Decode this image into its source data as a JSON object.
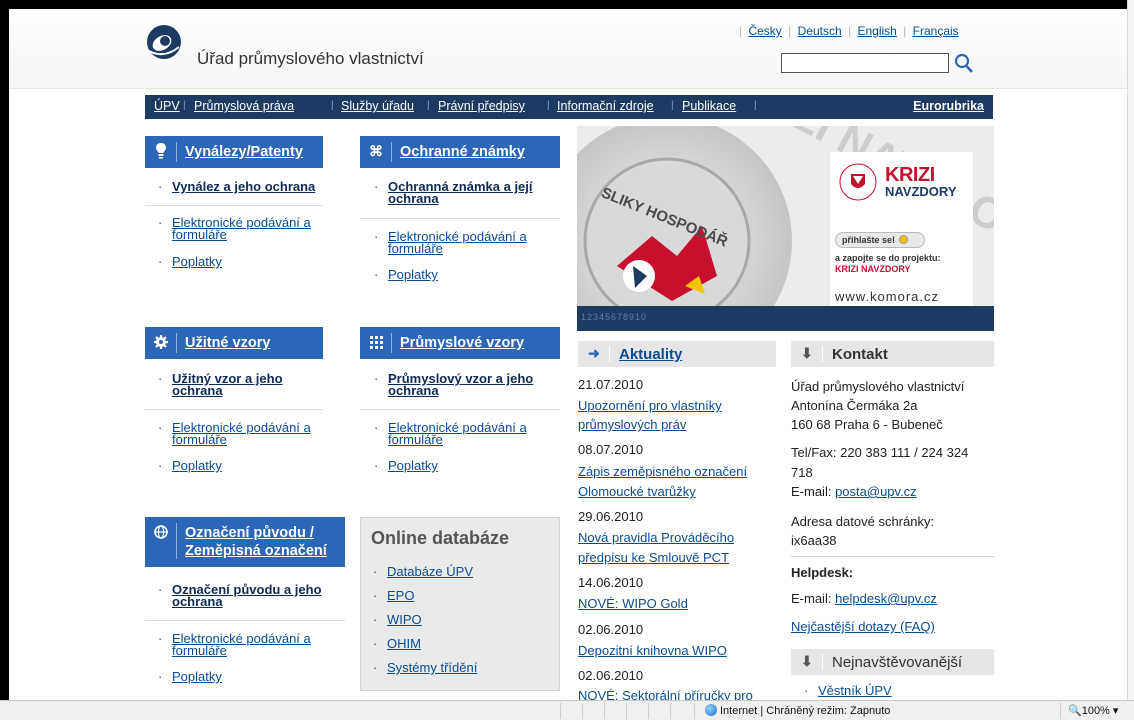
{
  "header": {
    "site_title": "Úřad průmyslového vlastnictví",
    "languages": [
      "Česky",
      "Deutsch",
      "English",
      "Français"
    ],
    "search_value": ""
  },
  "nav": {
    "items": [
      "ÚPV",
      "Průmyslová práva",
      "Služby úřadu",
      "Právní předpisy",
      "Informační zdroje",
      "Publikace"
    ],
    "right": "Eurorubrika"
  },
  "boxes": {
    "vynalezy": {
      "title": "Vynálezy/Patenty",
      "links": [
        "Vynález a jeho ochrana",
        "Elektronické podávání a",
        "formuláře",
        "Poplatky"
      ]
    },
    "znamky": {
      "title": "Ochranné známky",
      "links": [
        "Ochranná známka a její",
        "ochrana",
        "Elektronické podávání a",
        "formuláře",
        "Poplatky"
      ]
    },
    "uzitne": {
      "title": "Užitné vzory",
      "links": [
        "Užitný vzor a jeho",
        "ochrana",
        "Elektronické podávání a",
        "formuláře",
        "Poplatky"
      ]
    },
    "prumyslove": {
      "title": "Průmyslové vzory",
      "links": [
        "Průmyslový vzor a jeho",
        "ochrana",
        "Elektronické podávání a",
        "formuláře",
        "Poplatky"
      ]
    },
    "puvod": {
      "title_1": "Označení původu /",
      "title_2": "Zeměpisná označení",
      "links": [
        "Označení původu a jeho",
        "ochrana",
        "Elektronické podávání a",
        "formuláře",
        "Poplatky"
      ]
    }
  },
  "online_db": {
    "title": "Online databáze",
    "links": [
      "Databáze ÚPV",
      "EPO",
      "WIPO",
      "OHIM",
      "Systémy třídění"
    ]
  },
  "banner": {
    "brand_1": "KRIZI",
    "brand_2": "NAVZDORY",
    "button": "přihlašte se!",
    "tagline_1": "a zapojte se do projektu:",
    "tagline_2": "KRIZI NAVZDORY",
    "url": "www.komora.cz",
    "pager": "12345678910",
    "bg_word": "KRIZI NAVZDORY",
    "seal_text": "SLIKY HOSPODÁŘ"
  },
  "aktuality": {
    "title": "Aktuality",
    "items": [
      {
        "date": "21.07.2010",
        "line1": "Upozornění pro vlastníky",
        "line2": "průmyslových práv"
      },
      {
        "date": "08.07.2010",
        "line1": "Zápis zeměpisného označení",
        "line2": "Olomoucké tvarůžky"
      },
      {
        "date": "29.06.2010",
        "line1": "Nová pravidla Prováděcího",
        "line2": "předpisu ke Smlouvě PCT"
      },
      {
        "date": "14.06.2010",
        "line1": "NOVÉ: WIPO Gold",
        "line2": ""
      },
      {
        "date": "02.06.2010",
        "line1": "Depozitní knihovna WIPO",
        "line2": ""
      },
      {
        "date": "02.06.2010",
        "line1": "NOVÉ: Sektorální příručky pro",
        "line2": ""
      }
    ]
  },
  "kontakt": {
    "title": "Kontakt",
    "org": "Úřad průmyslového vlastnictví",
    "street": "Antonína Čermáka 2a",
    "city": "160 68 Praha 6 - Bubeneč",
    "telfax_1": "Tel/Fax: 220 383 111 / 224 324",
    "telfax_2": "718",
    "email_label": "E-mail:",
    "email": "posta@upv.cz",
    "ds_label": "Adresa datové schránky:",
    "ds": "ix6aa38",
    "helpdesk_title": "Helpdesk:",
    "helpdesk_email_label": "E-mail:",
    "helpdesk_email": "helpdesk@upv.cz",
    "faq": "Nejčastější dotazy (FAQ)"
  },
  "nejnav": {
    "title": "Nejnavštěvovanější",
    "items": [
      "Věstník ÚPV"
    ]
  },
  "statusbar": {
    "zone": "Internet | Chráněný režim: Zapnuto",
    "zoom": "100%"
  }
}
